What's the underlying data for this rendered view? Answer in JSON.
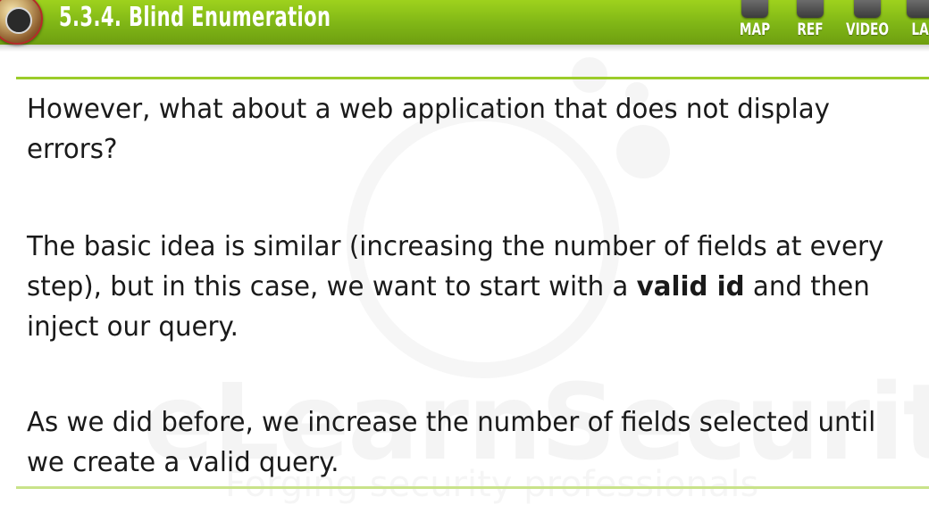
{
  "header": {
    "title": "5.3.4. Blind Enumeration",
    "nav": [
      {
        "id": "map",
        "label": "MAP",
        "icon": "map-icon"
      },
      {
        "id": "ref",
        "label": "REF",
        "icon": "reference-icon"
      },
      {
        "id": "video",
        "label": "VIDEO",
        "icon": "video-icon"
      },
      {
        "id": "lab",
        "label": "LA",
        "icon": "lab-icon"
      }
    ]
  },
  "content": {
    "p1": "However, what about a web application that does not display errors?",
    "p2_before": "The basic idea is similar (increasing the number of fields at every step), but in this case, we want to start with a ",
    "p2_bold": "valid id",
    "p2_after": " and then inject our query.",
    "p3": "As we did before, we increase the number of fields selected until we create a valid query."
  },
  "watermark": {
    "brand": "eLearnSecurity",
    "tagline": "Forging security professionals"
  },
  "colors": {
    "header_green": "#8cc31a",
    "rule_green": "#9ccc2a",
    "text": "#1a1a1a"
  }
}
